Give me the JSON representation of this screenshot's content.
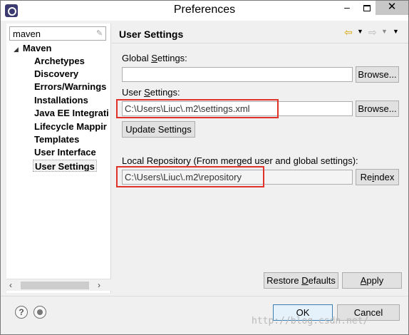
{
  "window": {
    "title": "Preferences"
  },
  "sidebar": {
    "filter_value": "maven",
    "root_label": "Maven",
    "items": [
      {
        "label": "Archetypes"
      },
      {
        "label": "Discovery"
      },
      {
        "label": "Errors/Warnings"
      },
      {
        "label": "Installations"
      },
      {
        "label": "Java EE Integrati"
      },
      {
        "label": "Lifecycle Mappir"
      },
      {
        "label": "Templates"
      },
      {
        "label": "User Interface"
      },
      {
        "label": "User Settings"
      }
    ],
    "selected_item": "User Settings"
  },
  "page": {
    "title": "User Settings",
    "global_settings": {
      "label_pre": "Global ",
      "label_mnemonic": "S",
      "label_post": "ettings:",
      "value": "",
      "browse_label": "Browse..."
    },
    "user_settings": {
      "label_pre": "User ",
      "label_mnemonic": "S",
      "label_post": "ettings:",
      "value": "C:\\Users\\Liuc\\.m2\\settings.xml",
      "browse_label": "Browse..."
    },
    "update_settings_label": "Update Settings",
    "local_repository": {
      "label": "Local Repository (From merged user and global settings):",
      "value": "C:\\Users\\Liuc\\.m2\\repository",
      "reindex_pre": "Re",
      "reindex_mnemonic": "i",
      "reindex_post": "ndex"
    },
    "restore_defaults_pre": "Restore ",
    "restore_defaults_mnemonic": "D",
    "restore_defaults_post": "efaults",
    "apply_label_mnemonic": "A",
    "apply_label_post": "pply"
  },
  "footer": {
    "ok_label": "OK",
    "cancel_label": "Cancel",
    "watermark": "http://blog.csdn.net/"
  },
  "colors": {
    "highlight_box": "#e0312a",
    "nav_back_arrow": "#d9a400"
  },
  "icons": {
    "app": "eclipse-icon",
    "help": "help-icon",
    "stop": "stop-icon"
  }
}
